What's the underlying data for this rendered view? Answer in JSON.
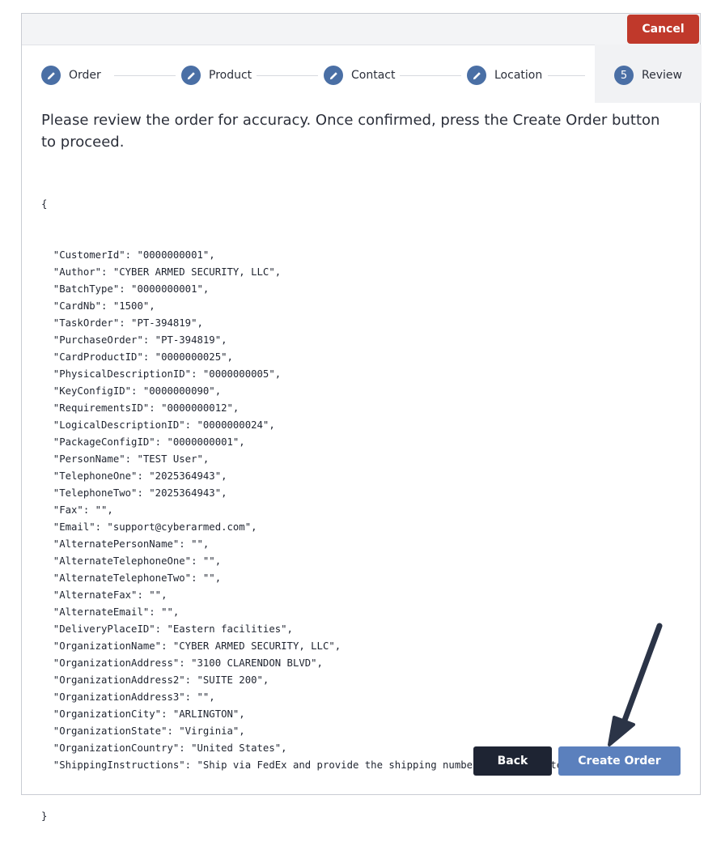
{
  "toolbar": {
    "cancel_label": "Cancel"
  },
  "steps": [
    {
      "label": "Order",
      "icon": "pencil-icon",
      "state": "completed"
    },
    {
      "label": "Product",
      "icon": "pencil-icon",
      "state": "completed"
    },
    {
      "label": "Contact",
      "icon": "pencil-icon",
      "state": "completed"
    },
    {
      "label": "Location",
      "icon": "pencil-icon",
      "state": "completed"
    },
    {
      "label": "Review",
      "number": "5",
      "state": "active"
    }
  ],
  "instructions": "Please review the order for accuracy. Once confirmed, press the Create Order button to proceed.",
  "order_json": {
    "open": "{",
    "close": "}",
    "lines": [
      "  \"CustomerId\": \"0000000001\",",
      "  \"Author\": \"CYBER ARMED SECURITY, LLC\",",
      "  \"BatchType\": \"0000000001\",",
      "  \"CardNb\": \"1500\",",
      "  \"TaskOrder\": \"PT-394819\",",
      "  \"PurchaseOrder\": \"PT-394819\",",
      "  \"CardProductID\": \"0000000025\",",
      "  \"PhysicalDescriptionID\": \"0000000005\",",
      "  \"KeyConfigID\": \"0000000090\",",
      "  \"RequirementsID\": \"0000000012\",",
      "  \"LogicalDescriptionID\": \"0000000024\",",
      "  \"PackageConfigID\": \"0000000001\",",
      "  \"PersonName\": \"TEST User\",",
      "  \"TelephoneOne\": \"2025364943\",",
      "  \"TelephoneTwo\": \"2025364943\",",
      "  \"Fax\": \"\",",
      "  \"Email\": \"support@cyberarmed.com\",",
      "  \"AlternatePersonName\": \"\",",
      "  \"AlternateTelephoneOne\": \"\",",
      "  \"AlternateTelephoneTwo\": \"\",",
      "  \"AlternateFax\": \"\",",
      "  \"AlternateEmail\": \"\",",
      "  \"DeliveryPlaceID\": \"Eastern facilities\",",
      "  \"OrganizationName\": \"CYBER ARMED SECURITY, LLC\",",
      "  \"OrganizationAddress\": \"3100 CLARENDON BLVD\",",
      "  \"OrganizationAddress2\": \"SUITE 200\",",
      "  \"OrganizationAddress3\": \"\",",
      "  \"OrganizationCity\": \"ARLINGTON\",",
      "  \"OrganizationState\": \"Virginia\",",
      "  \"OrganizationCountry\": \"United States\",",
      "  \"ShippingInstructions\": \"Ship via FedEx and provide the shipping number once completed\""
    ]
  },
  "actions": {
    "back_label": "Back",
    "create_label": "Create Order"
  },
  "colors": {
    "accent": "#4a6fa5",
    "cancel": "#c0392b",
    "back": "#1e2433",
    "create": "#5b80bd",
    "annotation_arrow": "#2b3447"
  }
}
